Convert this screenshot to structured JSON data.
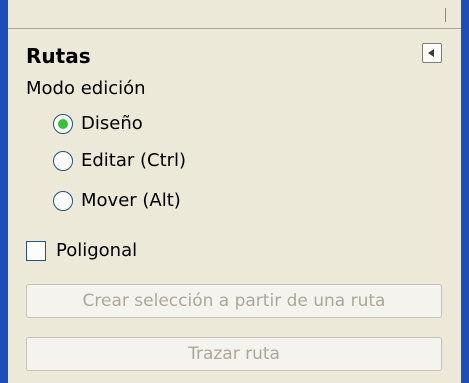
{
  "panel": {
    "title": "Rutas",
    "mode_label": "Modo edición",
    "modes": [
      {
        "label": "Diseño",
        "checked": true
      },
      {
        "label": "Editar (Ctrl)",
        "checked": false
      },
      {
        "label": "Mover (Alt)",
        "checked": false
      }
    ],
    "polygonal": {
      "label": "Poligonal",
      "checked": false
    },
    "buttons": {
      "create_selection": "Crear selección a partir de una ruta",
      "stroke_path": "Trazar ruta"
    }
  },
  "colors": {
    "window_border": "#1f4db8",
    "panel_bg": "#ece9d8",
    "radio_checked": "#34c23b",
    "disabled_text": "#aca899"
  },
  "icons": {
    "collapse": "collapse-left-arrow-icon"
  }
}
